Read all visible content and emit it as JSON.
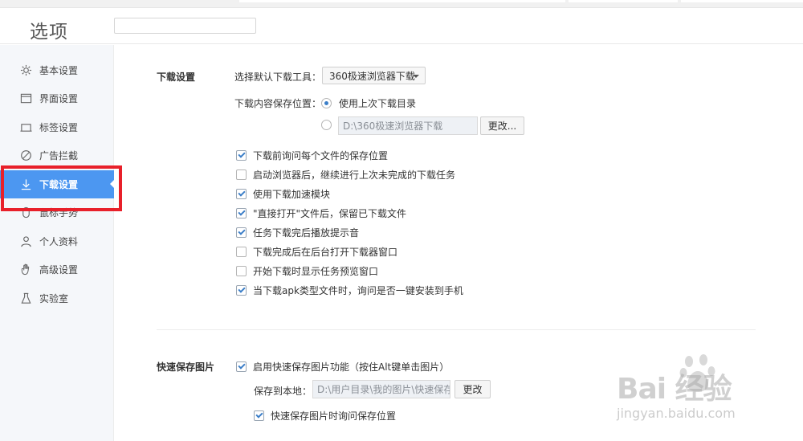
{
  "window": {
    "title": "选项"
  },
  "search": {
    "placeholder": ""
  },
  "sidebar": {
    "items": [
      {
        "label": "基本设置",
        "icon": "gear-icon"
      },
      {
        "label": "界面设置",
        "icon": "window-icon"
      },
      {
        "label": "标签设置",
        "icon": "tab-icon"
      },
      {
        "label": "广告拦截",
        "icon": "block-icon"
      },
      {
        "label": "下载设置",
        "icon": "download-icon",
        "active": true
      },
      {
        "label": "鼠标手势",
        "icon": "mouse-icon"
      },
      {
        "label": "个人资料",
        "icon": "user-icon"
      },
      {
        "label": "高级设置",
        "icon": "hand-icon"
      },
      {
        "label": "实验室",
        "icon": "flask-icon"
      }
    ]
  },
  "download": {
    "section_title": "下载设置",
    "tool_label": "选择默认下载工具：",
    "tool_value": "360极速浏览器下载",
    "save_location_label": "下载内容保存位置：",
    "use_last_dir": {
      "label": "使用上次下载目录",
      "selected": true
    },
    "custom_dir": {
      "path": "D:\\360极速浏览器下载",
      "selected": false
    },
    "change_button": "更改...",
    "options": [
      {
        "label": "下载前询问每个文件的保存位置",
        "checked": true
      },
      {
        "label": "启动浏览器后，继续进行上次未完成的下载任务",
        "checked": false
      },
      {
        "label": "使用下载加速模块",
        "checked": true
      },
      {
        "label": "\"直接打开\"文件后，保留已下载文件",
        "checked": true
      },
      {
        "label": "任务下载完后播放提示音",
        "checked": true
      },
      {
        "label": "下载完成后在后台打开下载器窗口",
        "checked": false
      },
      {
        "label": "开始下载时显示任务预览窗口",
        "checked": false
      },
      {
        "label": "当下载apk类型文件时，询问是否一键安装到手机",
        "checked": true
      }
    ]
  },
  "quicksave": {
    "section_title": "快速保存图片",
    "enable": {
      "label": "启用快速保存图片功能（按住Alt键单击图片）",
      "checked": true
    },
    "save_to_label": "保存到本地：",
    "save_path": "D:\\用户目录\\我的图片\\快速保存图片",
    "change_button": "更改",
    "ask_location": {
      "label": "快速保存图片时询问保存位置",
      "checked": true
    }
  },
  "watermark": {
    "brand": "Bai  经验",
    "url": "jingyan.baidu.com"
  },
  "colors": {
    "accent": "#4c97f1",
    "highlight_box": "#e8202a"
  }
}
